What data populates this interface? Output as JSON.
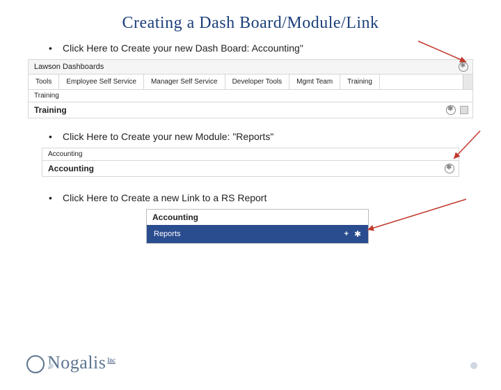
{
  "title": "Creating a Dash Board/Module/Link",
  "bullets": {
    "b1": "Click Here to Create your new Dash Board: Accounting\"",
    "b2": "Click Here to Create your new Module: \"Reports\"",
    "b3": "Click Here to Create a new Link to a RS Report"
  },
  "shot1": {
    "panel_title": "Lawson Dashboards",
    "tabs": [
      "Tools",
      "Employee Self Service",
      "Manager Self Service",
      "Developer Tools",
      "Mgmt Team",
      "Training"
    ],
    "subtab": "Training",
    "section": "Training"
  },
  "shot2": {
    "subtab": "Accounting",
    "section": "Accounting"
  },
  "shot3": {
    "head": "Accounting",
    "bar_label": "Reports",
    "plus": "+"
  },
  "logo": {
    "name": "Nogalis",
    "suffix": "Inc"
  }
}
